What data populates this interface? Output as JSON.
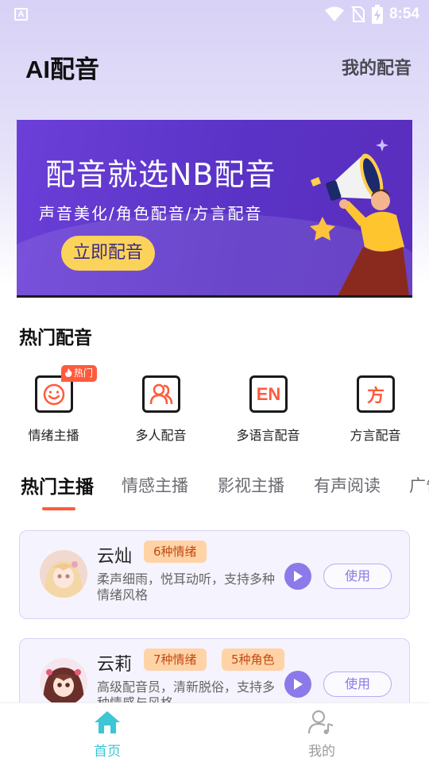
{
  "status_bar": {
    "notification_icon": "A",
    "time": "8:54",
    "icons": [
      "wifi-icon",
      "no-sim-icon",
      "battery-charging-icon"
    ]
  },
  "header": {
    "title": "AI配音",
    "my_dubbing": "我的配音"
  },
  "banner": {
    "title": "配音就选NB配音",
    "subtitle": "声音美化/角色配音/方言配音",
    "button": "立即配音"
  },
  "hot_section": {
    "title": "热门配音",
    "categories": [
      {
        "label": "情绪主播",
        "icon": "smile-face-icon",
        "tag": "热门"
      },
      {
        "label": "多人配音",
        "icon": "people-icon"
      },
      {
        "label": "多语言配音",
        "icon": "en-icon",
        "icon_text": "EN"
      },
      {
        "label": "方言配音",
        "icon": "dialect-icon",
        "icon_text": "方"
      }
    ]
  },
  "tabs": [
    {
      "label": "热门主播",
      "active": true
    },
    {
      "label": "情感主播"
    },
    {
      "label": "影视主播"
    },
    {
      "label": "有声阅读"
    },
    {
      "label": "广告"
    }
  ],
  "anchors": [
    {
      "name": "云灿",
      "badges": [
        "6种情绪"
      ],
      "description": "柔声细雨，悦耳动听，支持多种情绪风格",
      "use_label": "使用"
    },
    {
      "name": "云莉",
      "badges": [
        "7种情绪",
        "5种角色"
      ],
      "description": "高级配音员，清新脱俗，支持多种情感与风格",
      "use_label": "使用"
    }
  ],
  "bottom_nav": [
    {
      "label": "首页",
      "icon": "home-icon",
      "active": true
    },
    {
      "label": "我的",
      "icon": "user-music-icon"
    }
  ],
  "colors": {
    "accent": "#ff5a3c",
    "primary_purple": "#8c79ea",
    "nav_active": "#3cc6d6",
    "badge_bg": "#ffd3a6",
    "badge_text": "#c34a14"
  }
}
